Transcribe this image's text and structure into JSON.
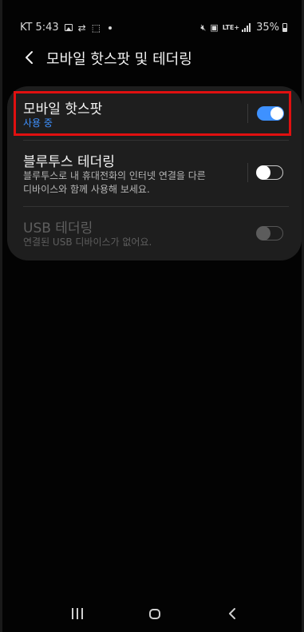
{
  "status_bar": {
    "carrier": "KT",
    "time": "5:43",
    "battery": "35%",
    "network": "LTE+",
    "icons_left": [
      "picture-icon",
      "sync-icon",
      "screenshot-icon",
      "dot-icon"
    ],
    "icons_right": [
      "mute-icon",
      "hd-icon",
      "lte-icon",
      "signal-icon",
      "battery-icon"
    ]
  },
  "header": {
    "title": "모바일 핫스팟 및 테더링"
  },
  "settings": [
    {
      "title": "모바일 핫스팟",
      "subtitle": "사용 중",
      "enabled": true,
      "on": true
    },
    {
      "title": "블루투스 테더링",
      "subtitle_line1": "블루투스로 내 휴대전화의 인터넷 연결을 다른",
      "subtitle_line2": "디바이스와 함께 사용해 보세요.",
      "enabled": true,
      "on": false
    },
    {
      "title": "USB 테더링",
      "subtitle": "연결된 USB 디바이스가 없어요.",
      "enabled": false,
      "on": false
    }
  ],
  "colors": {
    "accent": "#3e91ff",
    "highlight": "#e01010",
    "card": "#1e1e1e"
  }
}
